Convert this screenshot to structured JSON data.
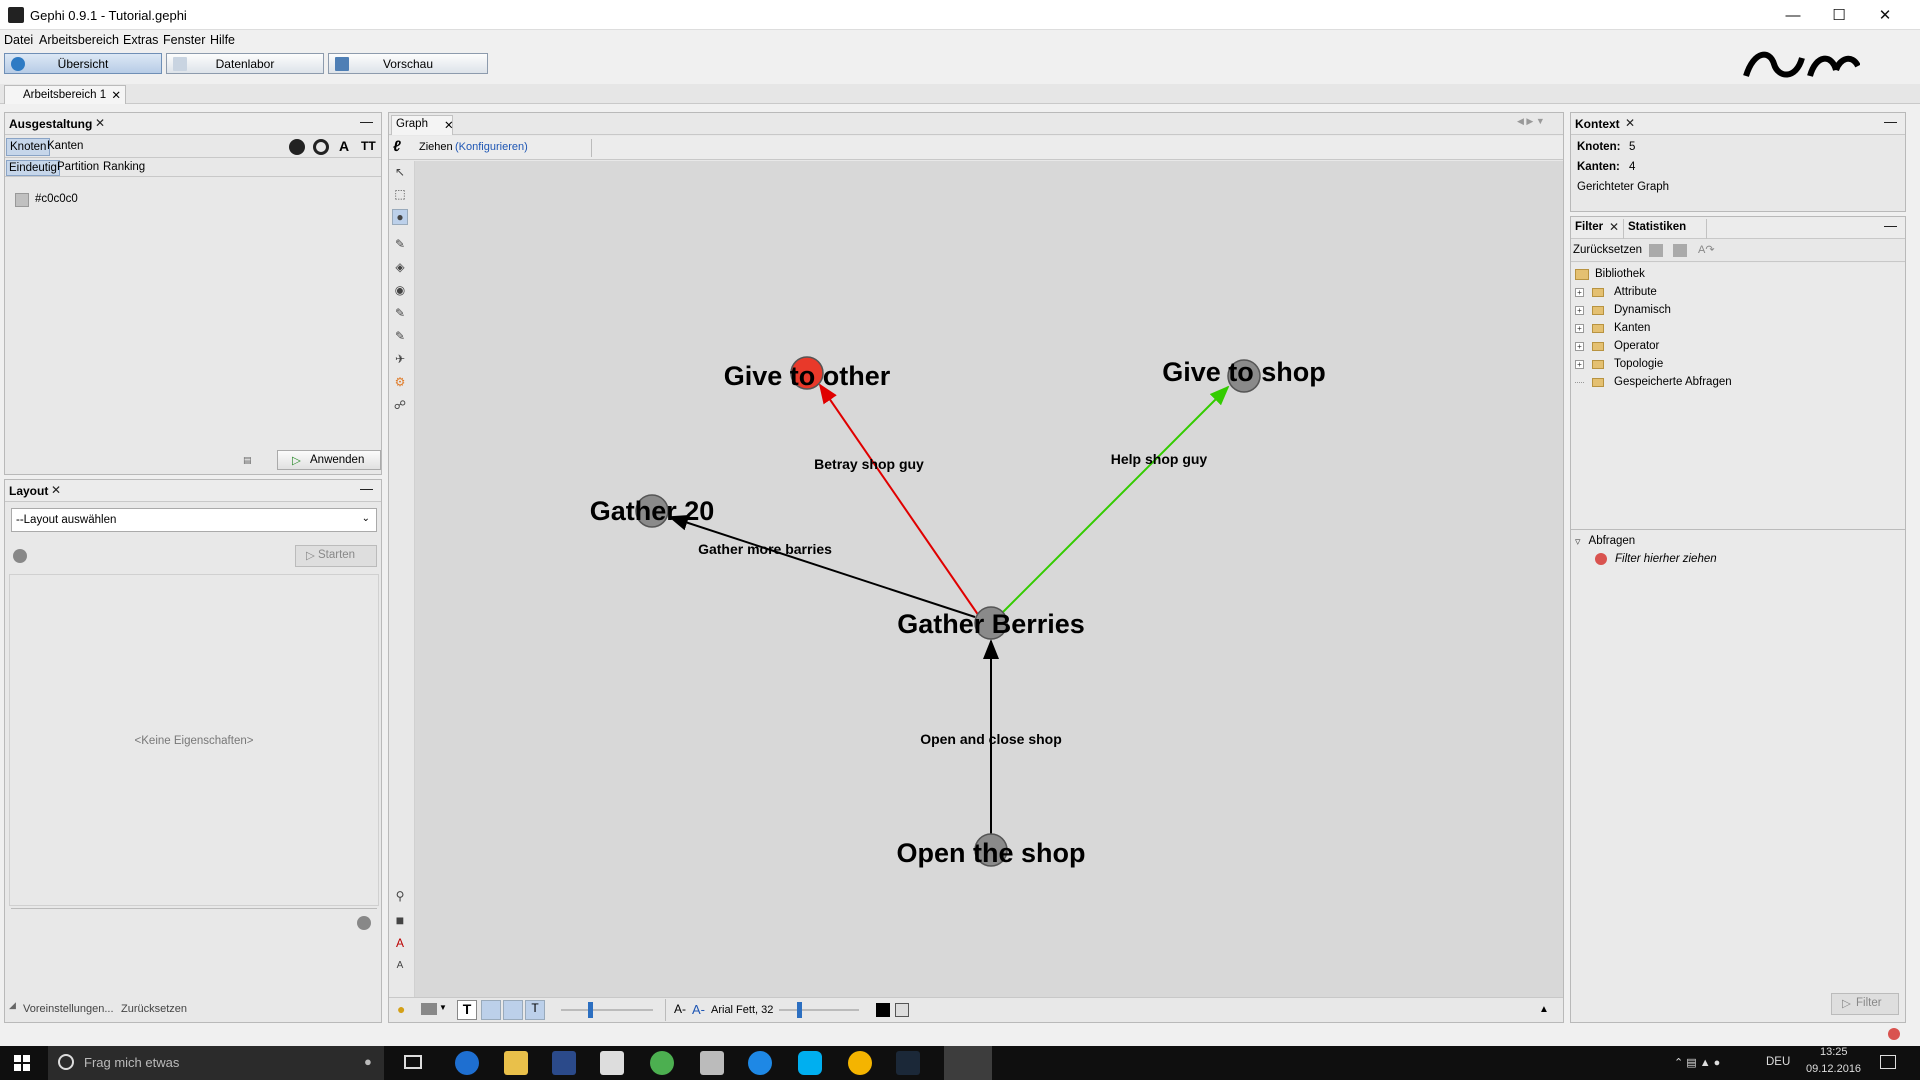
{
  "window": {
    "title": "Gephi 0.9.1 - Tutorial.gephi"
  },
  "menu": [
    "Datei",
    "Arbeitsbereich",
    "Extras",
    "Fenster",
    "Hilfe"
  ],
  "modes": {
    "overview": "Übersicht",
    "datalab": "Datenlabor",
    "preview": "Vorschau"
  },
  "workspace_tab": "Arbeitsbereich 1",
  "appearance": {
    "title": "Ausgestaltung",
    "tab_nodes": "Knoten",
    "tab_edges": "Kanten",
    "sub_unique": "Eindeutig",
    "sub_partition": "Partition",
    "sub_ranking": "Ranking",
    "color_value": "#c0c0c0",
    "apply": "Anwenden"
  },
  "layout": {
    "title": "Layout",
    "select": "--Layout auswählen",
    "start": "Starten",
    "no_props": "<Keine Eigenschaften>",
    "presets": "Voreinstellungen...",
    "reset": "Zurücksetzen"
  },
  "graph": {
    "tab": "Graph",
    "tool_label": "Ziehen",
    "configure": "(Konfigurieren)",
    "font_label": "Arial Fett, 32"
  },
  "nodes": [
    {
      "label": "Give to other",
      "color": "#e8392a"
    },
    {
      "label": "Give to shop",
      "color": "#8a8a8a"
    },
    {
      "label": "Gather 20",
      "color": "#8a8a8a"
    },
    {
      "label": "Gather Berries",
      "color": "#8a8a8a"
    },
    {
      "label": "Open the shop",
      "color": "#8a8a8a"
    }
  ],
  "edges": [
    {
      "label": "Betray shop guy",
      "color": "#e00000"
    },
    {
      "label": "Help shop guy",
      "color": "#33cc00"
    },
    {
      "label": "Gather more barries",
      "color": "#000000"
    },
    {
      "label": "Open and close shop",
      "color": "#000000"
    }
  ],
  "context": {
    "title": "Kontext",
    "nodes_label": "Knoten:",
    "nodes_value": "5",
    "edges_label": "Kanten:",
    "edges_value": "4",
    "graph_type": "Gerichteter Graph"
  },
  "filter": {
    "tab_filter": "Filter",
    "tab_stats": "Statistiken",
    "reset": "Zurücksetzen",
    "library": "Bibliothek",
    "items": [
      "Attribute",
      "Dynamisch",
      "Kanten",
      "Operator",
      "Topologie",
      "Gespeicherte Abfragen"
    ],
    "queries": "Abfragen",
    "drop_hint": "Filter hierher ziehen",
    "button": "Filter"
  },
  "taskbar": {
    "search": "Frag mich etwas",
    "lang": "DEU",
    "time": "13:25",
    "date": "09.12.2016"
  }
}
